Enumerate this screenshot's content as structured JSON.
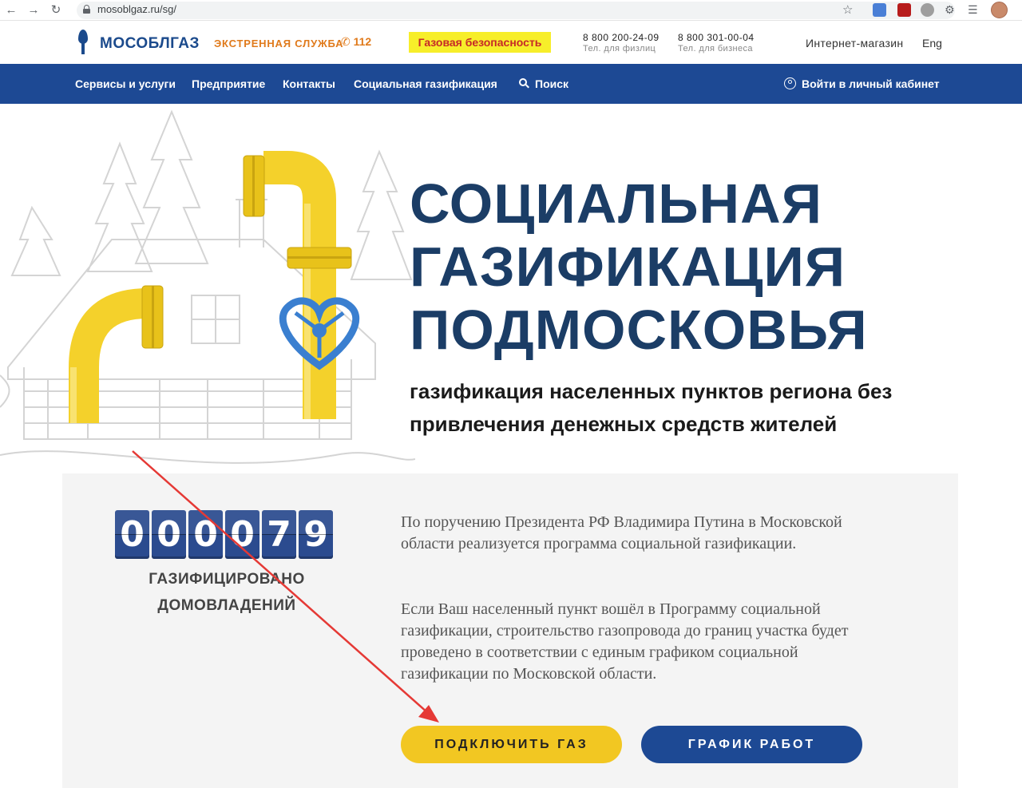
{
  "browser": {
    "url": "mosoblgaz.ru/sg/"
  },
  "header": {
    "logo": "МОСОБЛГАЗ",
    "emergency_label": "ЭКСТРЕННАЯ СЛУЖБА",
    "emergency_phone": "112",
    "gas_safety": "Газовая безопасность",
    "phones": [
      {
        "number": "8 800 200-24-09",
        "label": "Тел. для физлиц"
      },
      {
        "number": "8 800 301-00-04",
        "label": "Тел. для бизнеса"
      }
    ],
    "shop": "Интернет-магазин",
    "lang": "Eng"
  },
  "nav": {
    "items": [
      "Сервисы и услуги",
      "Предприятие",
      "Контакты",
      "Социальная газификация"
    ],
    "search": "Поиск",
    "login": "Войти в личный кабинет"
  },
  "hero": {
    "title": "СОЦИАЛЬНАЯ\nГАЗИФИКАЦИЯ\nПОДМОСКОВЬЯ",
    "subtitle": "газификация населенных пунктов региона без привлечения денежных средств жителей"
  },
  "counter": {
    "digits": [
      "0",
      "0",
      "0",
      "0",
      "7",
      "9"
    ],
    "caption": "ГАЗИФИЦИРОВАНО\nДОМОВЛАДЕНИЙ"
  },
  "info": {
    "paragraph_1": "По поручению Президента РФ Владимира Путина в Московской области реализуется программа социальной газификации.",
    "paragraph_2": "Если Ваш населенный пункт вошёл в Программу социальной газификации, строительство газопровода до границ участка будет проведено в соответствии с единым графиком социальной газификации по Московской области."
  },
  "buttons": {
    "connect": "ПОДКЛЮЧИТЬ ГАЗ",
    "schedule": "ГРАФИК РАБОТ"
  },
  "colors": {
    "brand_blue": "#1d4994",
    "title_blue": "#1b3d66",
    "emergency_orange": "#e07a1b",
    "safety_yellow": "#f7ee2a",
    "button_yellow": "#f2c722",
    "pipe_yellow": "#f4d12b",
    "arrow_red": "#e53935"
  }
}
